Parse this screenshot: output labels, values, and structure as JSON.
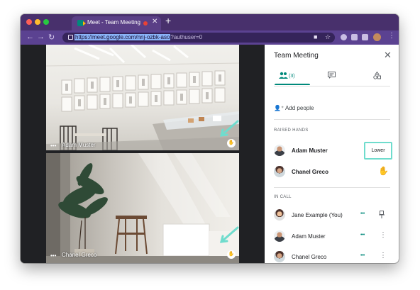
{
  "browser": {
    "tab_title": "Meet - Team Meeting",
    "tab_close": "✕",
    "new_tab": "+",
    "url_host": "https://meet.google.com/nnj-ozbk-aso",
    "url_query": "?authuser=0",
    "nav_back": "←",
    "nav_forward": "→",
    "nav_reload": "↻",
    "menu_icon": "⋮",
    "colors": {
      "frame": "#48306c",
      "toolbar": "#5b4291",
      "omnibox": "#35245a"
    }
  },
  "videos": [
    {
      "name": "Adam Muster",
      "menu": "•••",
      "hand_icon": "raised-hand-icon"
    },
    {
      "name": "Chanel Greco",
      "menu": "•••",
      "hand_icon": "raised-hand-icon"
    }
  ],
  "panel": {
    "title": "Team Meeting",
    "close": "✕",
    "people_count": "(3)",
    "add_people": "Add people",
    "raised_hands_header": "RAISED HANDS",
    "raised_hands": [
      {
        "name": "Adam Muster",
        "action": "Lower"
      },
      {
        "name": "Chanel Greco"
      }
    ],
    "in_call_header": "IN CALL",
    "in_call": [
      {
        "name": "Jane Example (You)",
        "more": "•••"
      },
      {
        "name": "Adam Muster",
        "more": "•••"
      },
      {
        "name": "Chanel Greco",
        "more": "•••"
      }
    ],
    "accent": "#00897b",
    "highlight": "#6fdccd"
  }
}
